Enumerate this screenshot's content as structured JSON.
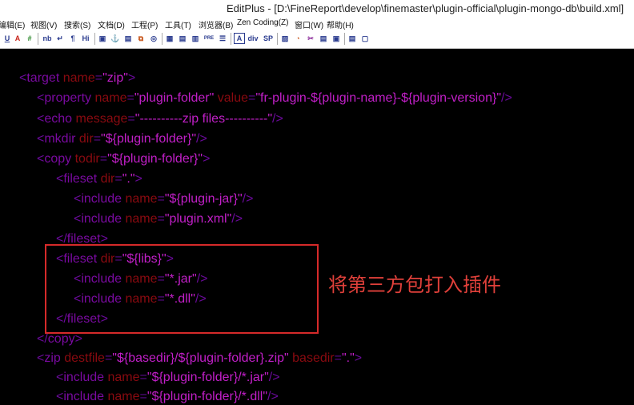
{
  "window": {
    "title": "EditPlus - [D:\\FineReport\\develop\\finemaster\\plugin-official\\plugin-mongo-db\\build.xml]"
  },
  "menu": [
    "编辑(E)",
    "视图(V)",
    "搜索(S)",
    "文档(D)",
    "工程(P)",
    "工具(T)",
    "浏览器(B)",
    "Zen Coding(Z)",
    "窗口(W)",
    "帮助(H)"
  ],
  "toolbar": [
    "U",
    "A",
    "#",
    "nb",
    "↵",
    "¶",
    "Hi",
    "▣",
    "⚓",
    "▤",
    "⧉",
    "◎",
    "▦",
    "▤",
    "▥",
    "PRE",
    "☰",
    "A",
    "div",
    "SP",
    "▧",
    "◔",
    "✂",
    "▤",
    "▣",
    "▤",
    "▢"
  ],
  "code": {
    "l1": {
      "t": "target",
      "a1": "name",
      "v1": "\"zip\""
    },
    "l2": {
      "t": "property",
      "a1": "name",
      "v1": "\"plugin-folder\"",
      "a2": "value",
      "v2": "\"fr-plugin-${plugin-name}-${plugin-version}\""
    },
    "l3": {
      "t": "echo",
      "a1": "message",
      "v1": "\"----------zip files----------\""
    },
    "l4": {
      "t": "mkdir",
      "a1": "dir",
      "v1": "\"${plugin-folder}\""
    },
    "l5": {
      "t": "copy",
      "a1": "todir",
      "v1": "\"${plugin-folder}\""
    },
    "l6": {
      "t": "fileset",
      "a1": "dir",
      "v1": "\".\""
    },
    "l7": {
      "t": "include",
      "a1": "name",
      "v1": "\"${plugin-jar}\""
    },
    "l8": {
      "t": "include",
      "a1": "name",
      "v1": "\"plugin.xml\""
    },
    "l9": {
      "t": "fileset"
    },
    "l10": {
      "t": "fileset",
      "a1": "dir",
      "v1": "\"${libs}\""
    },
    "l11": {
      "t": "include",
      "a1": "name",
      "v1": "\"*.jar\""
    },
    "l12": {
      "t": "include",
      "a1": "name",
      "v1": "\"*.dll\""
    },
    "l13": {
      "t": "fileset"
    },
    "l14": {
      "t": "copy"
    },
    "l15": {
      "t": "zip",
      "a1": "destfile",
      "v1": "\"${basedir}/${plugin-folder}.zip\"",
      "a2": "basedir",
      "v2": "\".\""
    },
    "l16": {
      "t": "include",
      "a1": "name",
      "v1": "\"${plugin-folder}/*.jar\""
    },
    "l17": {
      "t": "include",
      "a1": "name",
      "v1": "\"${plugin-folder}/*.dll\""
    }
  },
  "annotation": {
    "text": "将第三方包打入插件",
    "color": "#e0403a"
  }
}
